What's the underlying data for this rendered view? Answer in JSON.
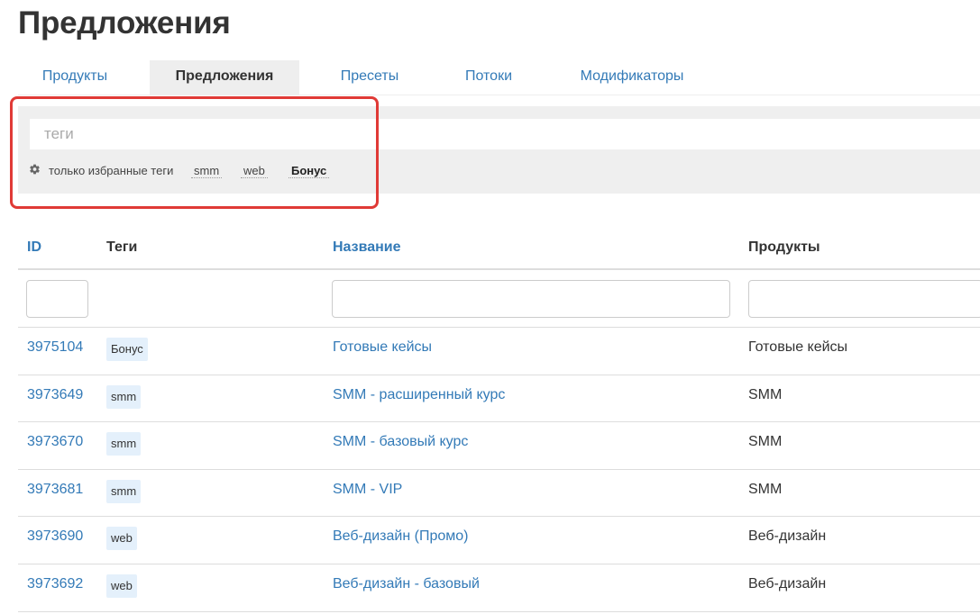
{
  "page_title": "Предложения",
  "tabs": [
    {
      "label": "Продукты",
      "active": false
    },
    {
      "label": "Предложения",
      "active": true
    },
    {
      "label": "Пресеты",
      "active": false
    },
    {
      "label": "Потоки",
      "active": false
    },
    {
      "label": "Модификаторы",
      "active": false
    }
  ],
  "filter": {
    "tags_placeholder": "теги",
    "tags_value": "",
    "settings_icon": "gear-icon",
    "only_favorite_label": "только избранные теги",
    "favorite_tags": [
      "smm",
      "web",
      "Бонус"
    ]
  },
  "table": {
    "columns": {
      "id": "ID",
      "tags": "Теги",
      "name": "Название",
      "products": "Продукты"
    },
    "filters": {
      "id": "",
      "name": "",
      "products": ""
    },
    "rows": [
      {
        "id": "3975104",
        "tag": "Бонус",
        "name": "Готовые кейсы",
        "products": "Готовые кейсы"
      },
      {
        "id": "3973649",
        "tag": "smm",
        "name": "SMM - расширенный курс",
        "products": "SMM"
      },
      {
        "id": "3973670",
        "tag": "smm",
        "name": "SMM - базовый курс",
        "products": "SMM"
      },
      {
        "id": "3973681",
        "tag": "smm",
        "name": "SMM - VIP",
        "products": "SMM"
      },
      {
        "id": "3973690",
        "tag": "web",
        "name": "Веб-дизайн (Промо)",
        "products": "Веб-дизайн"
      },
      {
        "id": "3973692",
        "tag": "web",
        "name": "Веб-дизайн - базовый",
        "products": "Веб-дизайн"
      }
    ]
  },
  "colors": {
    "link": "#337ab7",
    "highlight": "#e03a36",
    "panel_bg": "#efefef",
    "tag_badge_bg": "#e4f0fb"
  }
}
